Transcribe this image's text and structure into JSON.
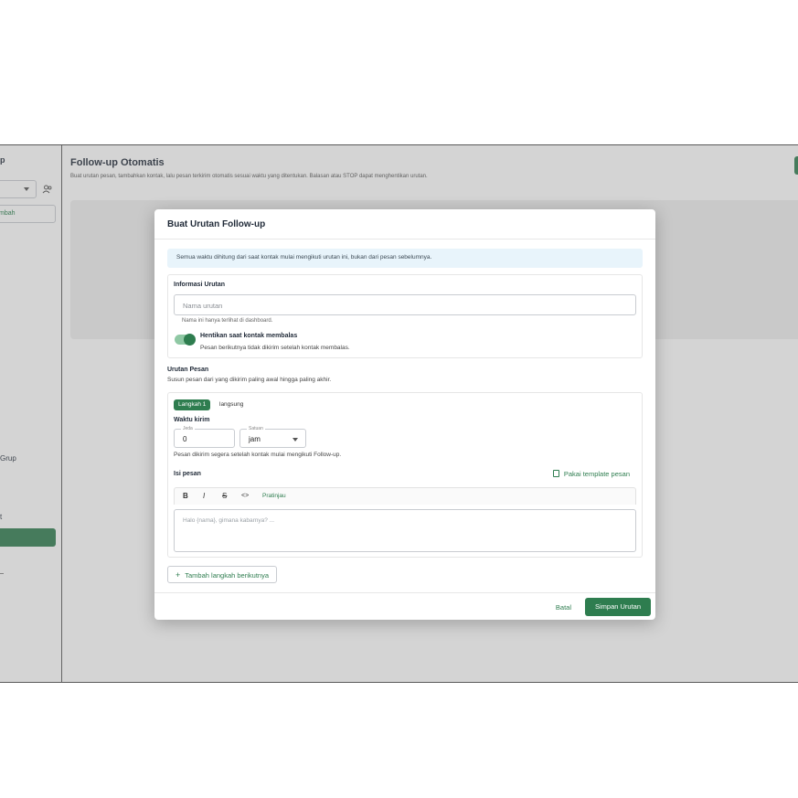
{
  "sidebar": {
    "title_fragment": "p",
    "add_fragment": "mbah",
    "grup_fragment": "Grup",
    "st_fragment": "t"
  },
  "page": {
    "title": "Follow-up Otomatis",
    "description": "Buat urutan pesan, tambahkan kontak, lalu pesan terkirim otomatis sesuai waktu yang ditentukan. Balasan atau STOP dapat menghentikan urutan."
  },
  "modal": {
    "title": "Buat Urutan Follow-up",
    "info": "Semua waktu dihitung dari saat kontak mulai mengikuti urutan ini, bukan dari pesan sebelumnya.",
    "info_section": {
      "title": "Informasi Urutan",
      "name_placeholder": "Nama urutan",
      "name_help": "Nama ini hanya terlihat di dashboard.",
      "toggle_label": "Hentikan saat kontak membalas",
      "toggle_help": "Pesan berikutnya tidak dikirim setelah kontak membalas.",
      "toggle_on": true
    },
    "sequence": {
      "title": "Urutan Pesan",
      "description": "Susun pesan dari yang dikirim paling awal hingga paling akhir.",
      "step": {
        "badge": "Langkah 1",
        "mode": "langsung",
        "send_time_label": "Waktu kirim",
        "jeda_legend": "Jeda",
        "jeda_value": "0",
        "satuan_legend": "Satuan",
        "satuan_value": "jam",
        "send_help": "Pesan dikirim segera setelah kontak mulai mengikuti Follow-up.",
        "message_label": "Isi pesan",
        "template_link": "Pakai template pesan",
        "toolbar": {
          "bold": "B",
          "italic": "I",
          "strike": "S",
          "code": "<>",
          "preview": "Pratinjau"
        },
        "message_placeholder": "Halo {nama}, gimana kabarnya? ..."
      },
      "add_step": "Tambah langkah berikutnya"
    },
    "footer": {
      "cancel": "Batal",
      "save": "Simpan Urutan"
    }
  },
  "colors": {
    "accent": "#2e7d4f",
    "info_bg": "#e8f4fb"
  }
}
